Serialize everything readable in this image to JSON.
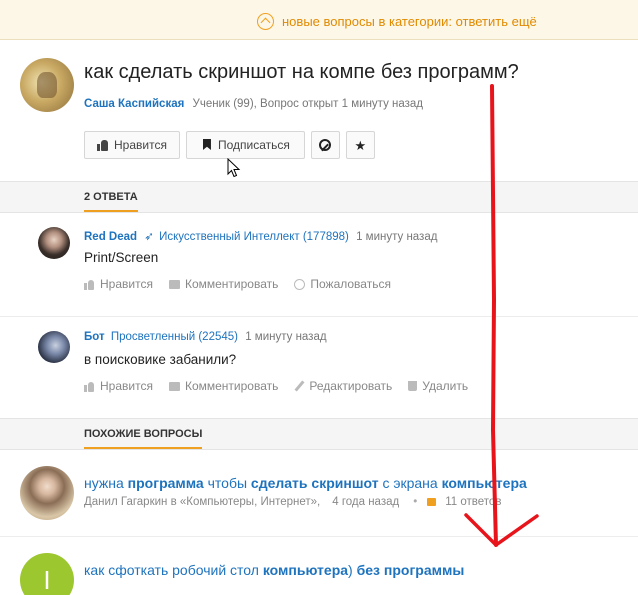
{
  "banner": {
    "text": "новые вопросы в категории: ответить ещё",
    "icon": "chevron-up-circle-icon",
    "color": "#e08a00"
  },
  "question": {
    "title": "как сделать скриншот на компе без программ?",
    "author": "Саша Каспийская",
    "meta": "Ученик (99), Вопрос открыт 1 минуту назад",
    "buttons": {
      "like": "Нравится",
      "subscribe": "Подписаться"
    }
  },
  "answers_header": "2 ОТВЕТА",
  "answers": [
    {
      "author": "Red Dead",
      "rank": "Искусственный Интеллект (177898)",
      "time": "1 минуту назад",
      "text": "Print/Screen",
      "actions": [
        "Нравится",
        "Комментировать",
        "Пожаловаться"
      ]
    },
    {
      "author": "Бот",
      "rank": "Просветленный (22545)",
      "time": "1 минуту назад",
      "text": "в поисковике забанили?",
      "actions": [
        "Нравится",
        "Комментировать",
        "Редактировать",
        "Удалить"
      ]
    }
  ],
  "similar_header": "ПОХОЖИЕ ВОПРОСЫ",
  "similar": [
    {
      "title_parts": [
        "нужна ",
        "программа",
        " чтобы ",
        "сделать скриншот",
        " с экрана ",
        "компьютера"
      ],
      "author_cat": "Данил Гагаркин в «Компьютеры, Интернет»,",
      "time": "4 года назад",
      "answers": "11 ответов"
    },
    {
      "title_parts": [
        "как сфоткать робочий стол ",
        "компьютера",
        ") ",
        "без программы"
      ],
      "avatar_letter": "I"
    }
  ],
  "colors": {
    "accent": "#f0a020",
    "link": "#1e73be",
    "annotation": "#e8141c"
  }
}
